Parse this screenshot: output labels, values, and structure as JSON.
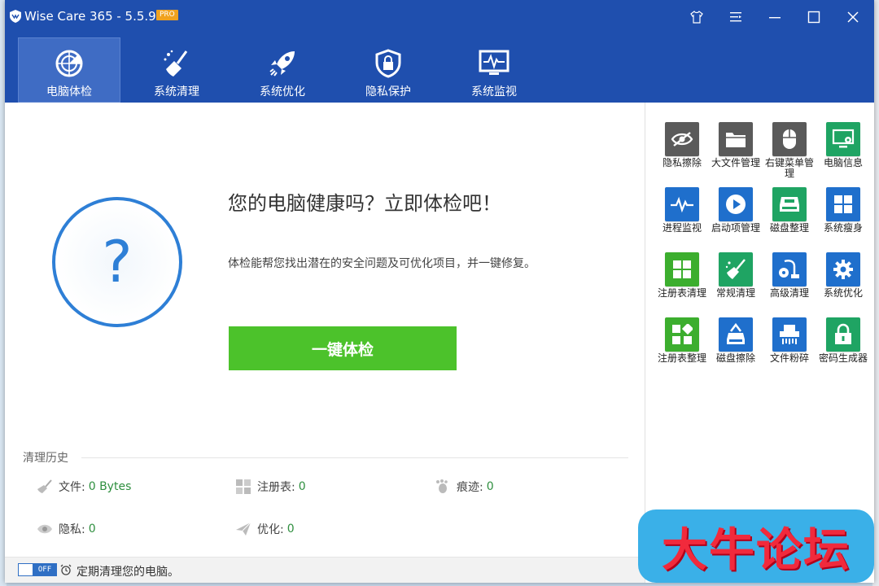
{
  "window": {
    "title": "Wise Care 365 - 5.5.9",
    "badge": "PRO"
  },
  "nav": [
    {
      "label": "电脑体检",
      "icon": "radar-icon"
    },
    {
      "label": "系统清理",
      "icon": "broom-icon"
    },
    {
      "label": "系统优化",
      "icon": "rocket-icon"
    },
    {
      "label": "隐私保护",
      "icon": "shield-lock-icon"
    },
    {
      "label": "系统监视",
      "icon": "monitor-pulse-icon"
    }
  ],
  "main": {
    "headline": "您的电脑健康吗？立即体检吧！",
    "subtext": "体检能帮您找出潜在的安全问题及可优化项目，并一键修复。",
    "check_button": "一键体检",
    "circle_symbol": "?"
  },
  "history": {
    "title": "清理历史",
    "stats": [
      {
        "label": "文件:",
        "value": "0 Bytes",
        "icon": "broom-icon"
      },
      {
        "label": "注册表:",
        "value": "0",
        "icon": "registry-icon"
      },
      {
        "label": "痕迹:",
        "value": "0",
        "icon": "footprint-icon"
      },
      {
        "label": "隐私:",
        "value": "0",
        "icon": "eye-icon"
      },
      {
        "label": "优化:",
        "value": "0",
        "icon": "paper-plane-icon"
      }
    ]
  },
  "footer": {
    "toggle_state": "OFF",
    "text": "定期清理您的电脑。"
  },
  "tools": [
    {
      "label": "隐私擦除",
      "color": "#5a5a5a",
      "icon": "eye-slash-icon"
    },
    {
      "label": "大文件管理",
      "color": "#5a5a5a",
      "icon": "folder-icon"
    },
    {
      "label": "右键菜单管理",
      "color": "#5a5a5a",
      "icon": "mouse-icon"
    },
    {
      "label": "电脑信息",
      "color": "#1fa463",
      "icon": "pc-gear-icon"
    },
    {
      "label": "进程监视",
      "color": "#1f6fcc",
      "icon": "pulse-icon"
    },
    {
      "label": "启动项管理",
      "color": "#1f6fcc",
      "icon": "play-icon"
    },
    {
      "label": "磁盘整理",
      "color": "#1fa463",
      "icon": "disk-icon"
    },
    {
      "label": "系统瘦身",
      "color": "#1f6fcc",
      "icon": "windows-icon"
    },
    {
      "label": "注册表清理",
      "color": "#3cae2e",
      "icon": "grid-icon"
    },
    {
      "label": "常规清理",
      "color": "#1fa463",
      "icon": "broom-icon"
    },
    {
      "label": "高级清理",
      "color": "#1f6fcc",
      "icon": "vacuum-icon"
    },
    {
      "label": "系统优化",
      "color": "#1f6fcc",
      "icon": "gear-icon"
    },
    {
      "label": "注册表整理",
      "color": "#3cae2e",
      "icon": "blocks-icon"
    },
    {
      "label": "磁盘擦除",
      "color": "#1f6fcc",
      "icon": "disk-erase-icon"
    },
    {
      "label": "文件粉碎",
      "color": "#1f6fcc",
      "icon": "shredder-icon"
    },
    {
      "label": "密码生成器",
      "color": "#1fa463",
      "icon": "lock-icon"
    }
  ],
  "watermark": "大牛论坛"
}
